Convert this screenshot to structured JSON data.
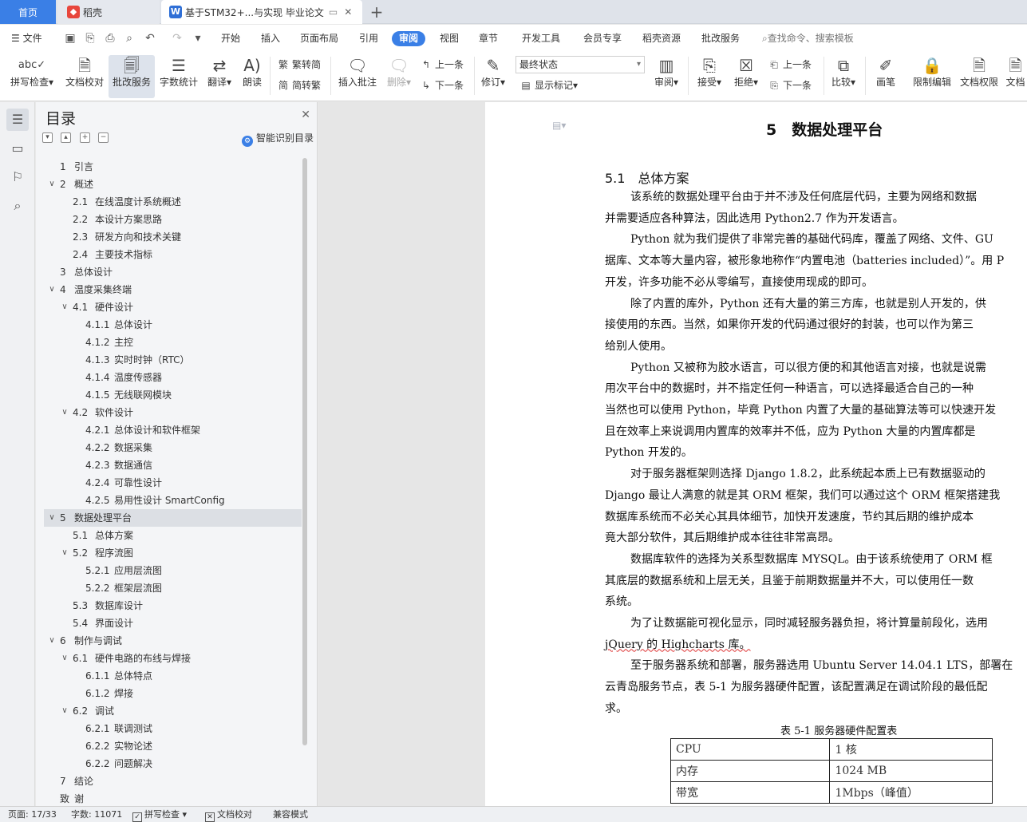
{
  "tabs": {
    "home": "首页",
    "daoke": "稻壳",
    "doc": "基于STM32+...与实现 毕业论文"
  },
  "menu": {
    "file": "文件",
    "items": [
      "开始",
      "插入",
      "页面布局",
      "引用",
      "审阅",
      "视图",
      "章节",
      "开发工具",
      "会员专享",
      "稻壳资源",
      "批改服务"
    ],
    "active": "审阅",
    "search": "查找命令、搜索模板"
  },
  "ribbon": {
    "spell": "拼写检查",
    "doccheck": "文档校对",
    "review_service": "批改服务",
    "wordcount": "字数统计",
    "translate": "翻译",
    "read": "朗读",
    "trad": "繁转简",
    "simp": "简转繁",
    "insert_comment": "插入批注",
    "delete": "删除",
    "prev": "上一条",
    "next": "下一条",
    "track": "修订",
    "mode": "最终状态",
    "show_marks": "显示标记",
    "review": "审阅",
    "accept": "接受",
    "reject": "拒绝",
    "prev2": "上一条",
    "next2": "下一条",
    "compare": "比较",
    "pen": "画笔",
    "restrict": "限制编辑",
    "perm": "文档权限",
    "doc_more": "文档"
  },
  "toc": {
    "title": "目录",
    "smart": "智能识别目录",
    "items": [
      {
        "num": "1",
        "text": "引言"
      },
      {
        "num": "2",
        "text": "概述"
      },
      {
        "num": "2.1",
        "text": "在线温度计系统概述"
      },
      {
        "num": "2.2",
        "text": "本设计方案思路"
      },
      {
        "num": "2.3",
        "text": "研发方向和技术关键"
      },
      {
        "num": "2.4",
        "text": "主要技术指标"
      },
      {
        "num": "3",
        "text": "总体设计"
      },
      {
        "num": "4",
        "text": "温度采集终端"
      },
      {
        "num": "4.1",
        "text": "硬件设计"
      },
      {
        "num": "4.1.1",
        "text": "总体设计"
      },
      {
        "num": "4.1.2",
        "text": "主控"
      },
      {
        "num": "4.1.3",
        "text": "实时时钟（RTC）"
      },
      {
        "num": "4.1.4",
        "text": "温度传感器"
      },
      {
        "num": "4.1.5",
        "text": "无线联网模块"
      },
      {
        "num": "4.2",
        "text": "软件设计"
      },
      {
        "num": "4.2.1",
        "text": "总体设计和软件框架"
      },
      {
        "num": "4.2.2",
        "text": "数据采集"
      },
      {
        "num": "4.2.3",
        "text": "数据通信"
      },
      {
        "num": "4.2.4",
        "text": "可靠性设计"
      },
      {
        "num": "4.2.5",
        "text": "易用性设计 SmartConfig"
      },
      {
        "num": "5",
        "text": "数据处理平台"
      },
      {
        "num": "5.1",
        "text": "总体方案"
      },
      {
        "num": "5.2",
        "text": "程序流图"
      },
      {
        "num": "5.2.1",
        "text": "应用层流图"
      },
      {
        "num": "5.2.2",
        "text": "框架层流图"
      },
      {
        "num": "5.3",
        "text": "数据库设计"
      },
      {
        "num": "5.4",
        "text": "界面设计"
      },
      {
        "num": "6",
        "text": "制作与调试"
      },
      {
        "num": "6.1",
        "text": "硬件电路的布线与焊接"
      },
      {
        "num": "6.1.1",
        "text": "总体特点"
      },
      {
        "num": "6.1.2",
        "text": "焊接"
      },
      {
        "num": "6.2",
        "text": "调试"
      },
      {
        "num": "6.2.1",
        "text": "联调测试"
      },
      {
        "num": "6.2.2",
        "text": "实物论述"
      },
      {
        "num": "6.2.2",
        "text": "问题解决"
      },
      {
        "num": "7",
        "text": "结论"
      },
      {
        "num": "致",
        "text": "谢"
      }
    ]
  },
  "doc": {
    "chapter": "5　数据处理平台",
    "section": "5.1　总体方案",
    "lines": [
      "该系统的数据处理平台由于并不涉及任何底层代码，主要为网络和数据",
      "并需要适应各种算法，因此选用 Python2.7 作为开发语言。",
      "Python 就为我们提供了非常完善的基础代码库，覆盖了网络、文件、GU",
      "据库、文本等大量内容，被形象地称作“内置电池（batteries included）”。用 P",
      "开发，许多功能不必从零编写，直接使用现成的即可。",
      "除了内置的库外，Python 还有大量的第三方库，也就是别人开发的，供",
      "接使用的东西。当然，如果你开发的代码通过很好的封装，也可以作为第三",
      "给别人使用。",
      "Python 又被称为胶水语言，可以很方便的和其他语言对接，也就是说需",
      "用次平台中的数据时，并不指定任何一种语言，可以选择最适合自己的一种",
      "当然也可以使用 Python，毕竟 Python 内置了大量的基础算法等可以快速开发",
      "且在效率上来说调用内置库的效率并不低，应为 Python 大量的内置库都是",
      "Python 开发的。",
      "对于服务器框架则选择 Django 1.8.2，此系统起本质上已有数据驱动的",
      "Django 最让人满意的就是其 ORM 框架，我们可以通过这个 ORM 框架搭建我",
      "数据库系统而不必关心其具体细节，加快开发速度，节约其后期的维护成本",
      "竟大部分软件，其后期维护成本往往非常高昂。",
      "数据库软件的选择为关系型数据库 MYSQL。由于该系统使用了 ORM 框",
      "其底层的数据系统和上层无关，且鉴于前期数据量并不大，可以使用任一数",
      "系统。",
      "为了让数据能可视化显示，同时减轻服务器负担，将计算量前段化，选用",
      "jQuery 的 Highcharts 库。",
      "至于服务器系统和部署，服务器选用 Ubuntu Server 14.04.1 LTS，部署在",
      "云青岛服务节点，表 5-1 为服务器硬件配置，该配置满足在调试阶段的最低配",
      "求。"
    ],
    "table_caption": "表 5-1 服务器硬件配置表",
    "table": [
      [
        "CPU",
        "1 核"
      ],
      [
        "内存",
        "1024 MB"
      ],
      [
        "带宽",
        "1Mbps（峰值）"
      ]
    ]
  },
  "status": {
    "page": "页面: 17/33",
    "words": "字数: 11071",
    "spell": "拼写检查",
    "doccheck": "文档校对",
    "compat": "兼容模式"
  }
}
